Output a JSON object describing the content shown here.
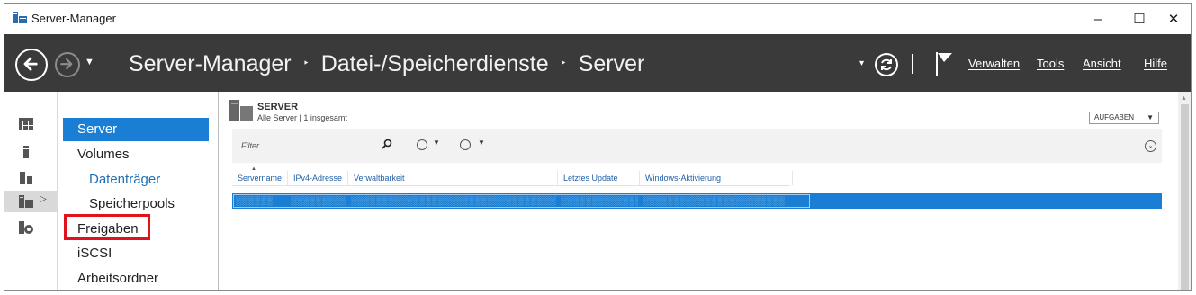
{
  "window": {
    "title": "Server-Manager",
    "controls": {
      "minimize": "–",
      "maximize": "☐",
      "close": "✕"
    }
  },
  "header": {
    "breadcrumb": [
      "Server-Manager",
      "Datei-/Speicherdienste",
      "Server"
    ],
    "separator": "‣",
    "menu": [
      "Verwalten",
      "Tools",
      "Ansicht",
      "Hilfe"
    ]
  },
  "rail": {
    "items": [
      "dashboard-icon",
      "local-server-icon",
      "all-servers-icon",
      "file-storage-icon",
      "iis-icon"
    ],
    "active_index": 3
  },
  "nav": {
    "items": [
      {
        "label": "Server",
        "selected": true
      },
      {
        "label": "Volumes"
      },
      {
        "label": "Datenträger",
        "indent": true,
        "link": true
      },
      {
        "label": "Speicherpools",
        "indent": true
      },
      {
        "label": "Freigaben"
      },
      {
        "label": "iSCSI"
      },
      {
        "label": "Arbeitsordner"
      }
    ]
  },
  "content": {
    "title": "SERVER",
    "subtitle": "Alle Server | 1 insgesamt",
    "tasks_label": "AUFGABEN",
    "filter_placeholder": "Filter",
    "columns": [
      "Servername",
      "IPv4-Adresse",
      "Verwaltbarkeit",
      "Letztes Update",
      "Windows-Aktivierung"
    ],
    "selected_row": [
      "░░░░░░",
      "░░░░░░░░░░░",
      "░░░░░░░░░░░░░░░░░░░░░░░░░░░░░░░░░░░░░",
      "░░░░░░░░░░░░░░░",
      "░░░░░░░░░░░░░░░░░░░░░░░"
    ]
  },
  "colors": {
    "header_bg": "#3a3a3a",
    "accent": "#1a7fd4",
    "highlight_box": "#e0121b",
    "link": "#1f6fb5"
  }
}
